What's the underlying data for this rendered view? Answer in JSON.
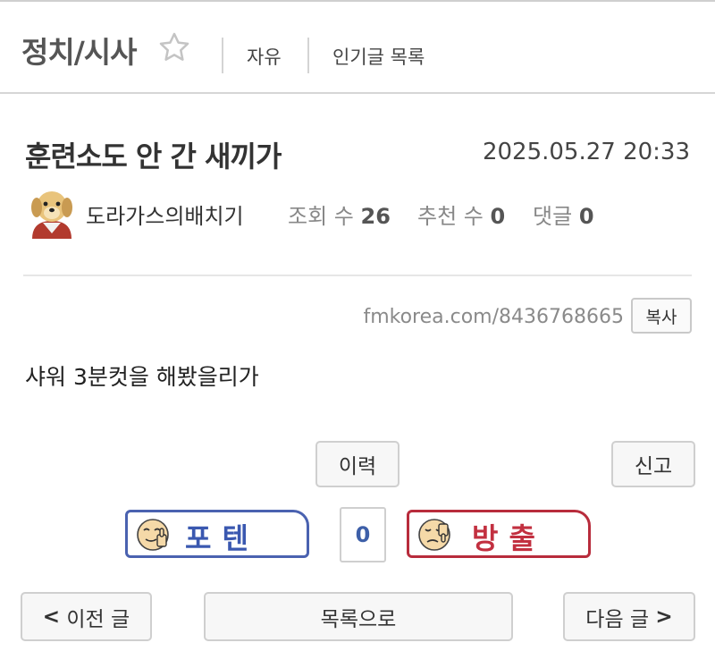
{
  "header": {
    "board_title": "정치/시사",
    "links": [
      "자유",
      "인기글 목록"
    ]
  },
  "post": {
    "title": "훈련소도 안 간 새끼가",
    "date": "2025.05.27 20:33",
    "author": "도라가스의배치기",
    "views_label": "조회 수",
    "views": "26",
    "recommend_label": "추천 수",
    "recommend": "0",
    "comments_label": "댓글",
    "comments": "0",
    "url": "fmkorea.com/8436768665",
    "copy_label": "복사",
    "body": "샤워 3분컷을 해봤을리가"
  },
  "actions": {
    "history_label": "이력",
    "report_label": "신고",
    "vote_up_label": "포텐",
    "vote_count": "0",
    "vote_down_label": "방출"
  },
  "nav": {
    "prev_label": "이전 글",
    "list_label": "목록으로",
    "next_label": "다음 글",
    "prev_arrow": "<",
    "next_arrow": ">"
  },
  "colors": {
    "vote_up": "#4a62b0",
    "vote_down": "#b82c3c",
    "count": "#3d5fa8"
  }
}
